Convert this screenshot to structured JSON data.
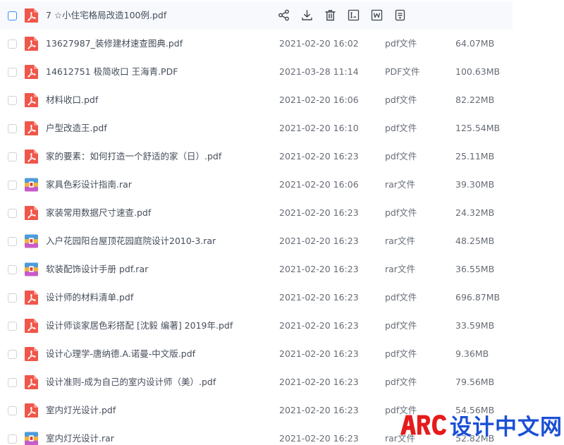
{
  "files": [
    {
      "name": "7 ☆小住宅格局改造100例.pdf",
      "date": "",
      "type": "",
      "size": "",
      "kind": "pdf"
    },
    {
      "name": "13627987_装修建材速查图典.pdf",
      "date": "2021-02-20 16:02",
      "type": "pdf文件",
      "size": "64.07MB",
      "kind": "pdf"
    },
    {
      "name": "14612751 极简收口 王海青.PDF",
      "date": "2021-03-28 11:14",
      "type": "PDF文件",
      "size": "100.63MB",
      "kind": "pdf"
    },
    {
      "name": "材料收口.pdf",
      "date": "2021-02-20 16:06",
      "type": "pdf文件",
      "size": "82.22MB",
      "kind": "pdf"
    },
    {
      "name": "户型改造王.pdf",
      "date": "2021-02-20 16:10",
      "type": "pdf文件",
      "size": "125.54MB",
      "kind": "pdf"
    },
    {
      "name": "家的要素：如何打造一个舒适的家（日）.pdf",
      "date": "2021-02-20 16:23",
      "type": "pdf文件",
      "size": "25.11MB",
      "kind": "pdf"
    },
    {
      "name": "家具色彩设计指南.rar",
      "date": "2021-02-20 16:06",
      "type": "rar文件",
      "size": "39.30MB",
      "kind": "rar"
    },
    {
      "name": "家装常用数据尺寸速查.pdf",
      "date": "2021-02-20 16:23",
      "type": "pdf文件",
      "size": "24.32MB",
      "kind": "pdf"
    },
    {
      "name": "入户花园阳台屋顶花园庭院设计2010-3.rar",
      "date": "2021-02-20 16:23",
      "type": "rar文件",
      "size": "48.25MB",
      "kind": "rar"
    },
    {
      "name": "软装配饰设计手册 pdf.rar",
      "date": "2021-02-20 16:23",
      "type": "rar文件",
      "size": "36.55MB",
      "kind": "rar"
    },
    {
      "name": "设计师的材料清单.pdf",
      "date": "2021-02-20 16:23",
      "type": "pdf文件",
      "size": "696.87MB",
      "kind": "pdf"
    },
    {
      "name": "设计师谈家居色彩搭配 [沈毅 编著] 2019年.pdf",
      "date": "2021-02-20 16:23",
      "type": "pdf文件",
      "size": "33.59MB",
      "kind": "pdf"
    },
    {
      "name": "设计心理学-唐纳德.A.诺曼-中文版.pdf",
      "date": "2021-02-20 16:23",
      "type": "pdf文件",
      "size": "9.36MB",
      "kind": "pdf"
    },
    {
      "name": "设计准则-成为自己的室内设计师（美）.pdf",
      "date": "2021-02-20 16:23",
      "type": "pdf文件",
      "size": "79.56MB",
      "kind": "pdf"
    },
    {
      "name": "室内灯光设计.pdf",
      "date": "2021-02-20 16:23",
      "type": "pdf文件",
      "size": "54.56MB",
      "kind": "pdf"
    },
    {
      "name": "室内灯光设计.rar",
      "date": "2021-02-20 16:23",
      "type": "rar文件",
      "size": "52.82MB",
      "kind": "rar"
    }
  ],
  "row_actions": [
    "share-icon",
    "download-icon",
    "delete-icon",
    "rename-icon",
    "word-convert-icon",
    "more-doc-icon"
  ],
  "watermark": {
    "logo": "ARC",
    "text": "设计中文网"
  },
  "colors": {
    "accent": "#3b8cff",
    "pdf_icon": "#f0564a",
    "watermark_logo": "#e51b1b",
    "watermark_text": "#1a4fd6"
  }
}
